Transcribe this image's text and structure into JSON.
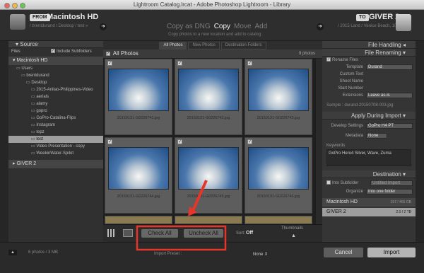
{
  "window": {
    "title": "Lightroom Catalog.lrcat - Adobe Photoshop Lightroom - Library"
  },
  "header": {
    "from_label": "FROM",
    "from_volume": "Macintosh HD",
    "from_path": "/ brentdurand / Desktop / test »",
    "to_label": "TO",
    "to_volume": "GIVER 2",
    "to_path": "/ 2015 Land / Venice Beach, 10...",
    "modes": [
      {
        "label": "Copy as DNG",
        "active": false
      },
      {
        "label": "Copy",
        "active": true
      },
      {
        "label": "Move",
        "active": false
      },
      {
        "label": "Add",
        "active": false
      }
    ],
    "mode_subtitle": "Copy photos to a new location and add to catalog"
  },
  "source_panel": {
    "title": "Source",
    "files_label": "Files",
    "include_subfolders": "Include Subfolders",
    "volume": "Macintosh HD",
    "tree": [
      {
        "label": "Users",
        "indent": 1,
        "selected": false
      },
      {
        "label": "brentdurand",
        "indent": 2,
        "selected": false
      },
      {
        "label": "Desktop",
        "indent": 3,
        "selected": false
      },
      {
        "label": "2015-Anilao-Philippines-Video",
        "indent": 4,
        "selected": false
      },
      {
        "label": "aerials",
        "indent": 4,
        "selected": false
      },
      {
        "label": "alamy",
        "indent": 4,
        "selected": false
      },
      {
        "label": "gopro",
        "indent": 4,
        "selected": false
      },
      {
        "label": "GoPro-Catalina-Flips",
        "indent": 4,
        "selected": false
      },
      {
        "label": "Instagram",
        "indent": 4,
        "selected": false
      },
      {
        "label": "tepz",
        "indent": 4,
        "selected": false
      },
      {
        "label": "test",
        "indent": 4,
        "selected": true
      },
      {
        "label": "Video Presentation - copy",
        "indent": 4,
        "selected": false
      },
      {
        "label": "WeekinWater-Spilot",
        "indent": 4,
        "selected": false
      }
    ],
    "volume2": "GIVER 2"
  },
  "center": {
    "tabs": [
      {
        "label": "All Photos",
        "active": true
      },
      {
        "label": "New Photos",
        "active": false
      },
      {
        "label": "Destination Folders",
        "active": false
      }
    ],
    "grid_title": "All Photos",
    "photo_count": "9 photos",
    "photos": [
      {
        "filename": "20150131-G0226741.jpg"
      },
      {
        "filename": "20150131-G0226742.jpg"
      },
      {
        "filename": "20150131-G0226743.jpg"
      },
      {
        "filename": "20150131-G0226744.jpg"
      },
      {
        "filename": "20150131-G0226745.jpg"
      },
      {
        "filename": "20150131-G0226746.jpg"
      }
    ],
    "check_all": "Check All",
    "uncheck_all": "Uncheck All",
    "sort_label": "Sort:",
    "sort_value": "Off",
    "thumbnails_label": "Thumbnails"
  },
  "right_panel": {
    "file_handling": "File Handling",
    "file_renaming": "File Renaming",
    "rename_files": "Rename Files",
    "template_label": "Template",
    "template_value": "Durand",
    "custom_text": "Custom Text",
    "shoot_name": "Shoot Name",
    "start_number": "Start Number",
    "extensions_label": "Extensions",
    "extensions_value": "Leave as-is",
    "sample": "Sample : durand-20150708-003.jpg",
    "apply_during_import": "Apply During Import",
    "develop_label": "Develop Settings",
    "develop_value": "GoPro H4 PT",
    "metadata_label": "Metadata",
    "metadata_value": "None",
    "keywords_label": "Keywords",
    "keywords_value": "GoPro Hero4 Silver, Wave, Zuma",
    "destination": "Destination",
    "into_subfolder": "Into Subfolder",
    "subfolder_value": "Untitled Import",
    "organize_label": "Organize",
    "organize_value": "Into one folder",
    "vol1": "Macintosh HD",
    "vol1_size": "197 / 465 GB",
    "vol2": "GIVER 2",
    "vol2_size": "2.0 / 2 TB"
  },
  "footer": {
    "summary": "6 photos / 3 MB",
    "preset_label": "Import Preset :",
    "preset_value": "None",
    "cancel": "Cancel",
    "import": "Import"
  },
  "colors": {
    "accent_red": "#e8352a",
    "panel": "#353535"
  }
}
